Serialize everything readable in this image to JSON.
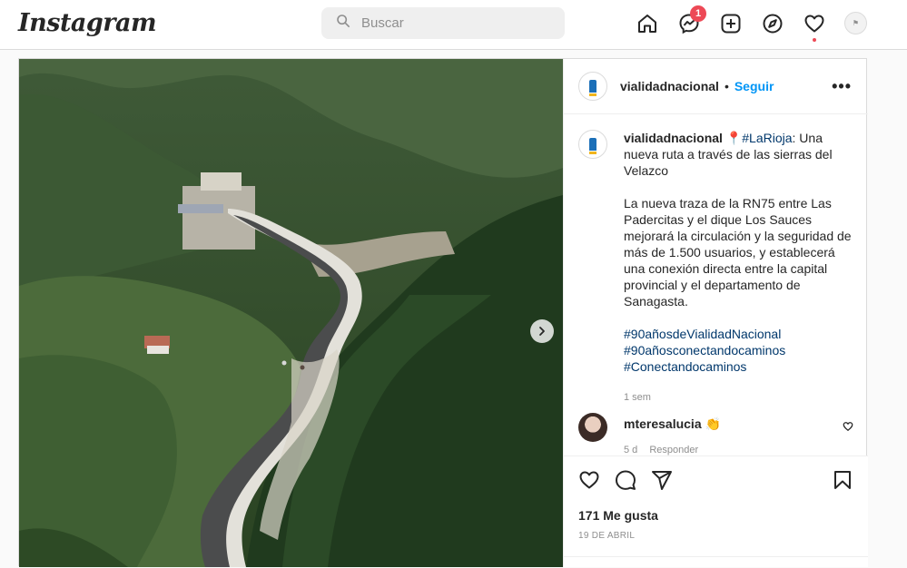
{
  "app": {
    "logo": "Instagram"
  },
  "search": {
    "placeholder": "Buscar"
  },
  "nav": {
    "icons": [
      "home-icon",
      "messenger-icon",
      "new-post-icon",
      "explore-icon",
      "activity-heart-icon",
      "profile-avatar"
    ],
    "messages_badge": "1"
  },
  "post": {
    "author": "vialidadnacional",
    "separator": "•",
    "follow_label": "Seguir",
    "more_label": "•••",
    "caption": {
      "author": "vialidadnacional",
      "pin": "📍",
      "hashtag_location": "#LaRioja",
      "title_rest": ": Una nueva ruta a través de las sierras del Velazco",
      "paragraph": "La nueva traza de la RN75 entre Las Padercitas y el dique Los Sauces mejorará la circulación y la seguridad de más de 1.500 usuarios, y establecerá una conexión directa entre la capital provincial y el departamento de Sanagasta.",
      "hashtags": [
        "#90añosdeVialidadNacional",
        "#90añosconectandocaminos",
        "#Conectandocaminos"
      ],
      "time": "1 sem"
    },
    "comment": {
      "user": "mteresalucia",
      "emoji": "👏",
      "time": "5 d",
      "reply_label": "Responder"
    },
    "likes": "171 Me gusta",
    "date": "19 DE ABRIL"
  },
  "colors": {
    "link_blue": "#0095f6",
    "hashtag": "#00376b",
    "badge_red": "#ed4956",
    "border": "#dbdbdb"
  }
}
